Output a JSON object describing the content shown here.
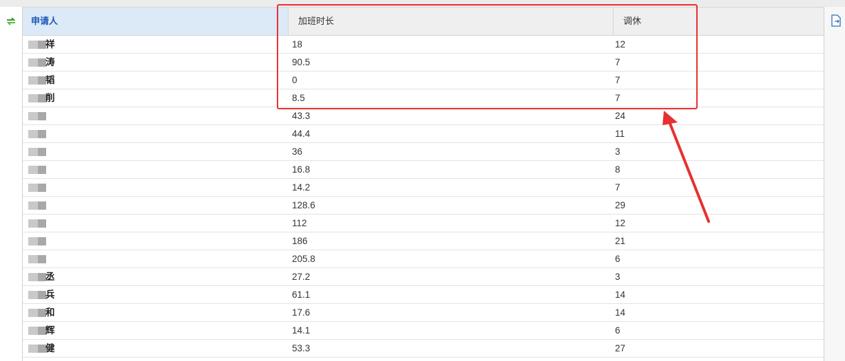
{
  "colors": {
    "annotation": "#e8302e",
    "header_selected_bg": "#dce9f7",
    "header_selected_text": "#1a57b8"
  },
  "toolbar": {
    "refresh_icon": "refresh-icon",
    "export_icon": "export-icon"
  },
  "table": {
    "columns": {
      "applicant": "申请人",
      "overtime": "加班时长",
      "leave": "调休"
    },
    "rows": [
      {
        "name": "祥",
        "overtime": "18",
        "leave": "12"
      },
      {
        "name": "涛",
        "overtime": "90.5",
        "leave": "7"
      },
      {
        "name": "韬",
        "overtime": "0",
        "leave": "7"
      },
      {
        "name": "削",
        "overtime": "8.5",
        "leave": "7"
      },
      {
        "name": "",
        "overtime": "43.3",
        "leave": "24"
      },
      {
        "name": "",
        "overtime": "44.4",
        "leave": "11"
      },
      {
        "name": "",
        "overtime": "36",
        "leave": "3"
      },
      {
        "name": "",
        "overtime": "16.8",
        "leave": "8"
      },
      {
        "name": "",
        "overtime": "14.2",
        "leave": "7"
      },
      {
        "name": "",
        "overtime": "128.6",
        "leave": "29"
      },
      {
        "name": "",
        "overtime": "112",
        "leave": "12"
      },
      {
        "name": "",
        "overtime": "186",
        "leave": "21"
      },
      {
        "name": "",
        "overtime": "205.8",
        "leave": "6"
      },
      {
        "name": "丞",
        "overtime": "27.2",
        "leave": "3"
      },
      {
        "name": "兵",
        "overtime": "61.1",
        "leave": "14"
      },
      {
        "name": "和",
        "overtime": "17.6",
        "leave": "14"
      },
      {
        "name": "辉",
        "overtime": "14.1",
        "leave": "6"
      },
      {
        "name": "健",
        "overtime": "53.3",
        "leave": "27"
      }
    ]
  }
}
